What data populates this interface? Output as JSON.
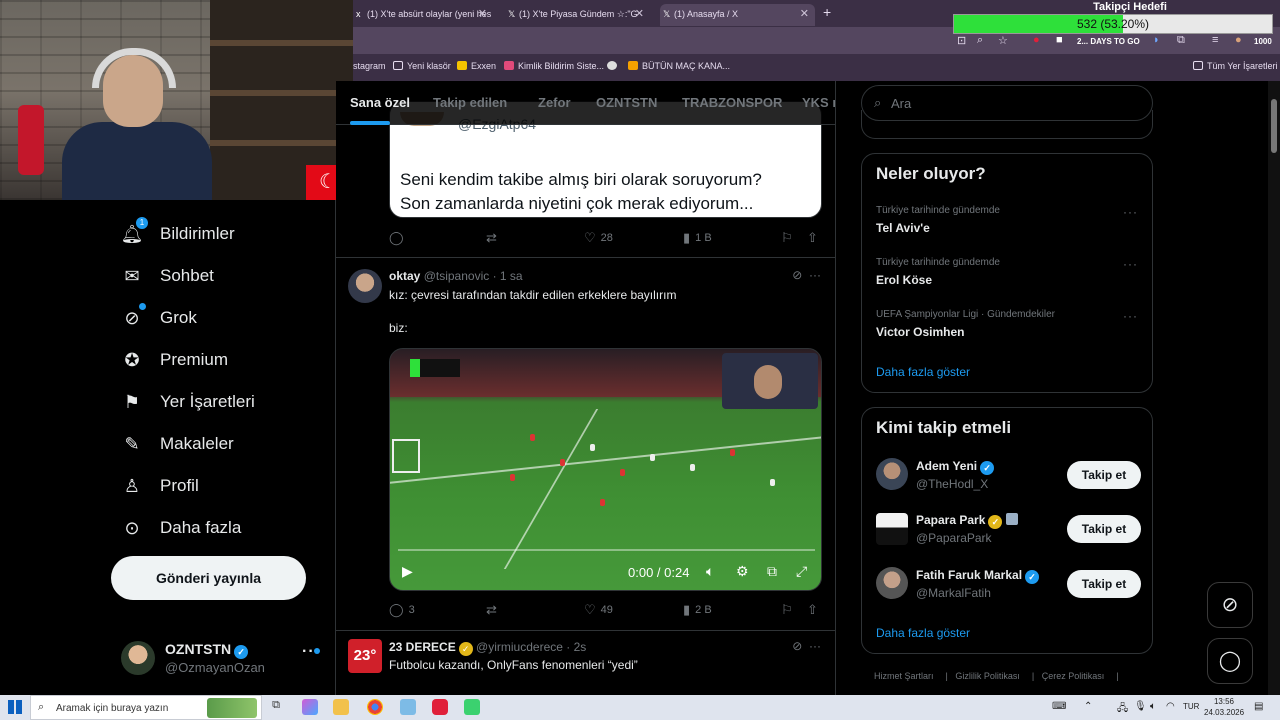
{
  "browser": {
    "tabs": [
      {
        "label": "(1) X'te absürt olaylar (yeni hes"
      },
      {
        "label": "(1) X'te Piyasa Gündem ☆:\"G"
      },
      {
        "label": "(1) Anasayfa / X"
      }
    ],
    "bookmarks": [
      {
        "label": "stagram"
      },
      {
        "label": "Yeni klasör"
      },
      {
        "label": "Exxen"
      },
      {
        "label": "Kimlik Bildirim Siste..."
      },
      {
        "label": "BÜTÜN MAÇ KANA..."
      },
      {
        "label": "Tüm Yer İşaretleri"
      }
    ]
  },
  "overlay": {
    "goal_title": "Takipçi Hedefi",
    "goal_text": "532 (53.20%)",
    "goal_progress": 0.532,
    "days_to_go": "2... DAYS TO GO",
    "goal_target": "1000"
  },
  "nav": {
    "items": [
      {
        "label": "Bildirimler",
        "icon": "bell-icon",
        "badge": "1"
      },
      {
        "label": "Sohbet",
        "icon": "mail-icon"
      },
      {
        "label": "Grok",
        "icon": "grok-icon"
      },
      {
        "label": "Premium",
        "icon": "verified-icon"
      },
      {
        "label": "Yer İşaretleri",
        "icon": "bookmark-icon"
      },
      {
        "label": "Makaleler",
        "icon": "article-icon"
      },
      {
        "label": "Profil",
        "icon": "person-icon"
      },
      {
        "label": "Daha fazla",
        "icon": "more-circle-icon"
      }
    ],
    "post_button": "Gönderi yayınla",
    "account": {
      "name": "OZNTSTN",
      "handle": "@OzmayanOzan"
    }
  },
  "timeline": {
    "tabs": [
      "Sana özel",
      "Takip edilen",
      "Zefor",
      "OZNTSTN",
      "TRABZONSPOR",
      "YKS n"
    ],
    "quote": {
      "handle": "@EzgiAtp64",
      "text_line1": "Seni kendim takibe almış biri olarak soruyorum?",
      "text_line2": "Son zamanlarda niyetini çok merak ediyorum..."
    },
    "quote_actions": {
      "replies": "",
      "reposts": "",
      "likes": "28",
      "views": "1 B"
    },
    "post1": {
      "name": "oktay",
      "handle": "@tsipanovic",
      "time": "· 1 sa",
      "text_line1": "kız: çevresi tarafından takdir edilen erkeklere bayılırım",
      "text_line2": "biz:",
      "video_time": "0:00 / 0:24",
      "actions": {
        "replies": "3",
        "reposts": "",
        "likes": "49",
        "views": "2 B"
      }
    },
    "post2": {
      "name": "23 DERECE",
      "handle": "@yirmiucderece",
      "time": "· 2s",
      "text_line1": "Futbolcu kazandı, OnlyFans fenomenleri “yedi”",
      "avatar_text": "23°"
    }
  },
  "right": {
    "search_placeholder": "Ara",
    "trends_title": "Neler oluyor?",
    "trends": [
      {
        "meta": "Türkiye tarihinde gündemde",
        "name": "Tel Aviv'e"
      },
      {
        "meta": "Türkiye tarihinde gündemde",
        "name": "Erol Köse"
      },
      {
        "meta": "UEFA Şampiyonlar Ligi · Gündemdekiler",
        "name": "Victor Osimhen"
      }
    ],
    "trends_show_more": "Daha fazla göster",
    "wtf_title": "Kimi takip etmeli",
    "wtf": [
      {
        "name": "Adem Yeni",
        "handle": "@TheHodl_X",
        "button": "Takip et"
      },
      {
        "name": "Papara Park",
        "handle": "@PaparaPark",
        "button": "Takip et"
      },
      {
        "name": "Fatih Faruk Markal",
        "handle": "@MarkalFatih",
        "button": "Takip et"
      }
    ],
    "wtf_show_more": "Daha fazla göster",
    "footer": [
      "Hizmet Şartları",
      "Gizlilik Politikası",
      "Çerez Politikası"
    ]
  },
  "taskbar": {
    "search_placeholder": "Aramak için buraya yazın",
    "lang": "TUR",
    "time": "13:56",
    "date": "24.03.2026"
  },
  "colors": {
    "accent": "#1d9bf0",
    "gold_check": "#e2b719",
    "goal_fill": "#2ee03a"
  }
}
